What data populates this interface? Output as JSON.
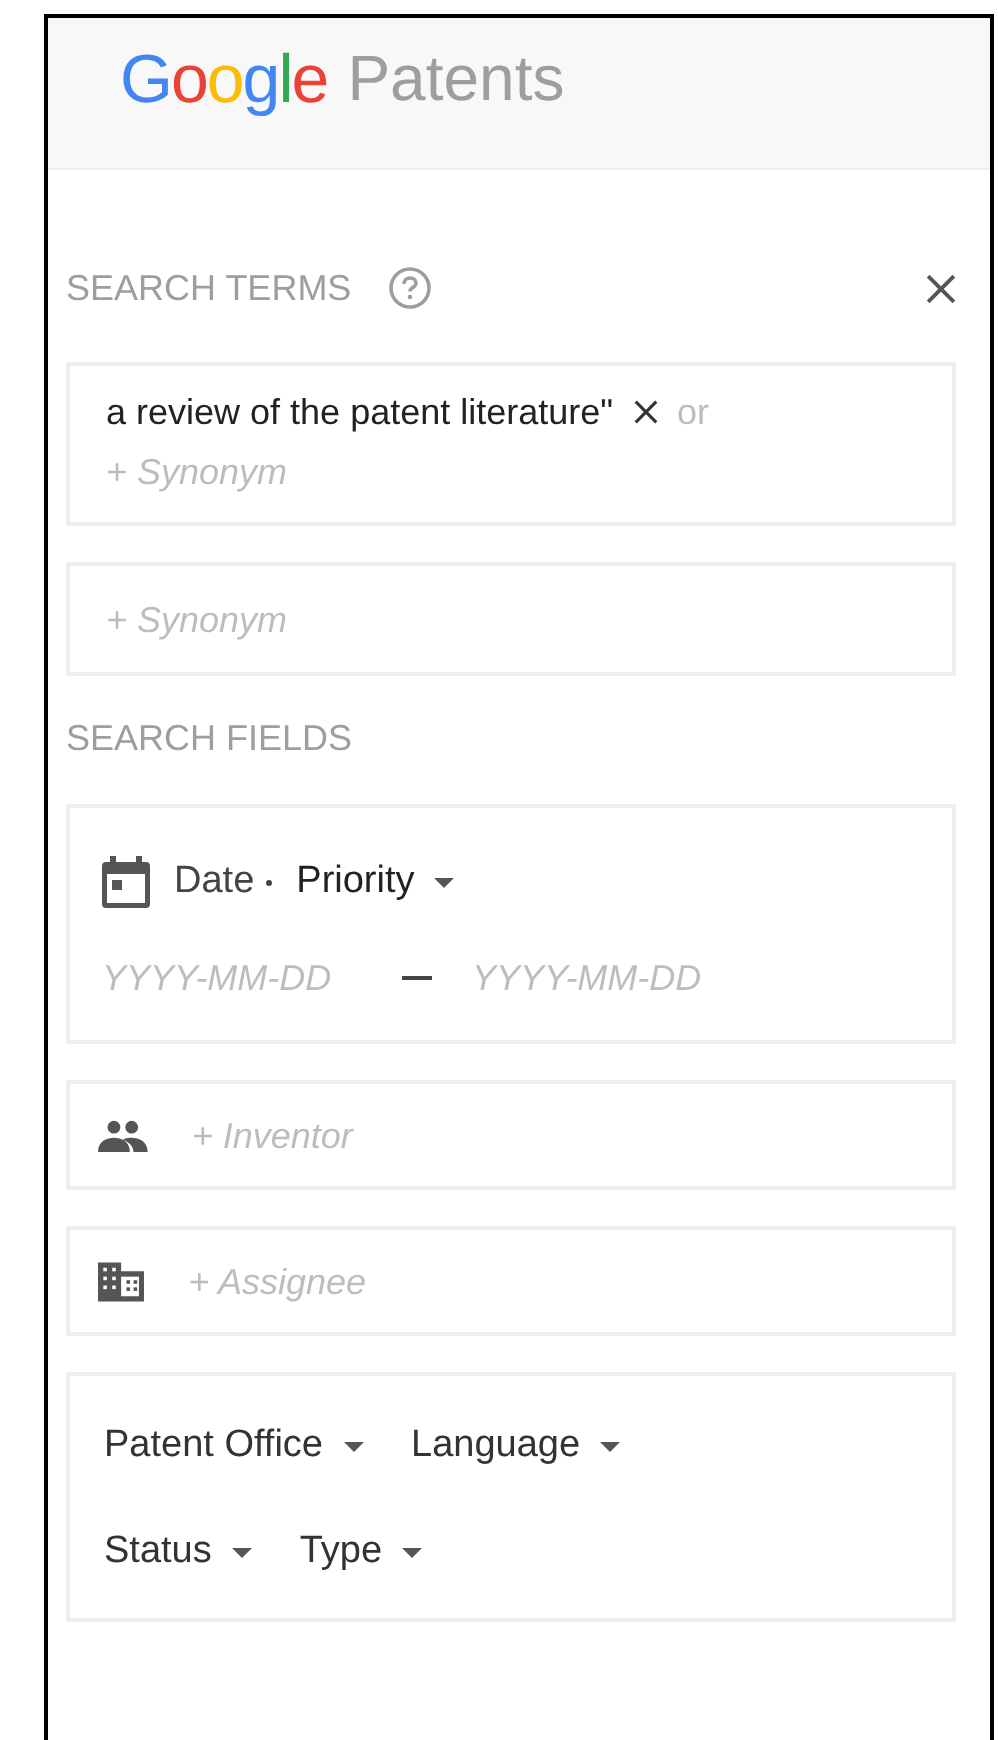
{
  "header": {
    "logo": "Google",
    "product": "Patents"
  },
  "search_terms": {
    "heading": "SEARCH TERMS",
    "groups": [
      {
        "terms": [
          "a review of the patent literature\""
        ],
        "connector": "or",
        "placeholder": "+ Synonym"
      },
      {
        "placeholder": "+ Synonym"
      }
    ]
  },
  "search_fields": {
    "heading": "SEARCH FIELDS",
    "date": {
      "label": "Date",
      "type": "Priority",
      "from_placeholder": "YYYY-MM-DD",
      "to_placeholder": "YYYY-MM-DD"
    },
    "people": [
      {
        "kind": "inventor",
        "placeholder": "+ Inventor"
      },
      {
        "kind": "assignee",
        "placeholder": "+ Assignee"
      }
    ],
    "filters": [
      [
        "Patent Office",
        "Language"
      ],
      [
        "Status",
        "Type"
      ]
    ]
  }
}
